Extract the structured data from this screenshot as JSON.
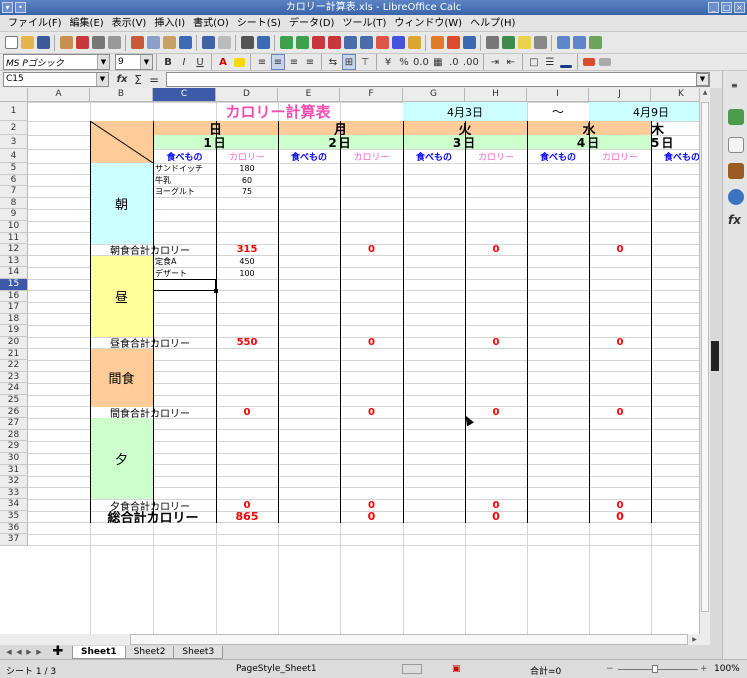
{
  "window": {
    "title": "カロリー計算表.xls - LibreOffice Calc"
  },
  "menu": [
    "ファイル(F)",
    "編集(E)",
    "表示(V)",
    "挿入(I)",
    "書式(O)",
    "シート(S)",
    "データ(D)",
    "ツール(T)",
    "ウィンドウ(W)",
    "ヘルプ(H)"
  ],
  "format_toolbar": {
    "font_name": "MS Pゴシック",
    "font_size": "9"
  },
  "formula_bar": {
    "cell_ref": "C15",
    "formula": ""
  },
  "columns": [
    "A",
    "B",
    "C",
    "D",
    "E",
    "F",
    "G",
    "H",
    "I",
    "J",
    "K"
  ],
  "selected_cell": "C15",
  "rows": [
    "1",
    "2",
    "3",
    "4",
    "5",
    "6",
    "7",
    "8",
    "9",
    "10",
    "11",
    "12",
    "13",
    "14",
    "15",
    "16",
    "17",
    "18",
    "19",
    "20",
    "21",
    "22",
    "23",
    "24",
    "25",
    "26",
    "27",
    "28",
    "29",
    "30",
    "31",
    "32",
    "33",
    "34",
    "35",
    "36",
    "37"
  ],
  "sheet": {
    "title": "カロリー計算表",
    "date_from": "4月3日",
    "tilde": "～",
    "date_to": "4月9日",
    "days": [
      {
        "weekday": "日",
        "date": "1日",
        "food_label": "食べもの",
        "cal_label": "カロリー"
      },
      {
        "weekday": "月",
        "date": "2日",
        "food_label": "食べもの",
        "cal_label": "カロリー"
      },
      {
        "weekday": "火",
        "date": "3日",
        "food_label": "食べもの",
        "cal_label": "カロリー"
      },
      {
        "weekday": "水",
        "date": "4日",
        "food_label": "食べもの",
        "cal_label": "カロリー"
      },
      {
        "weekday": "木",
        "date": "5日",
        "food_label": "食べもの",
        "cal_label": "カロリー"
      }
    ],
    "sections": {
      "breakfast": {
        "label": "朝",
        "total_label": "朝食合計カロリー",
        "totals": [
          "315",
          "0",
          "0",
          "0",
          "0"
        ],
        "items": [
          {
            "food": "サンドイッチ",
            "cal": "180"
          },
          {
            "food": "牛乳",
            "cal": "60"
          },
          {
            "food": "ヨーグルト",
            "cal": "75"
          }
        ]
      },
      "lunch": {
        "label": "昼",
        "total_label": "昼食合計カロリー",
        "totals": [
          "550",
          "0",
          "0",
          "0",
          "0"
        ],
        "items": [
          {
            "food": "定食A",
            "cal": "450"
          },
          {
            "food": "デザート",
            "cal": "100"
          }
        ]
      },
      "snack": {
        "label": "間食",
        "total_label": "間食合計カロリー",
        "totals": [
          "0",
          "0",
          "0",
          "0",
          "0"
        ]
      },
      "dinner": {
        "label": "夕",
        "total_label": "夕食合計カロリー",
        "totals": [
          "0",
          "0",
          "0",
          "0",
          "0"
        ]
      }
    },
    "grand_total": {
      "label": "総合計カロリー",
      "totals": [
        "865",
        "0",
        "0",
        "0",
        "0"
      ]
    }
  },
  "sheet_tabs": [
    "Sheet1",
    "Sheet2",
    "Sheet3"
  ],
  "status": {
    "sheet": "シート 1 / 3",
    "style": "PageStyle_Sheet1",
    "sum": "合計=0",
    "zoom": "100%"
  },
  "colors": {
    "title_pink": "#f04fb0",
    "header_orange": "#ffcc99",
    "day_green": "#ccffcc",
    "food_blue": "#0000ff",
    "cal_pink": "#ff66cc",
    "morning_cyan": "#ccffff",
    "lunch_yellow": "#ffff99",
    "snack_orange": "#ffcc99",
    "dinner_green": "#ccffcc",
    "total_row": "#ffe6cc",
    "grand_total": "#33cccc",
    "red_value": "#ff0000",
    "date_cyan": "#ccffff"
  }
}
